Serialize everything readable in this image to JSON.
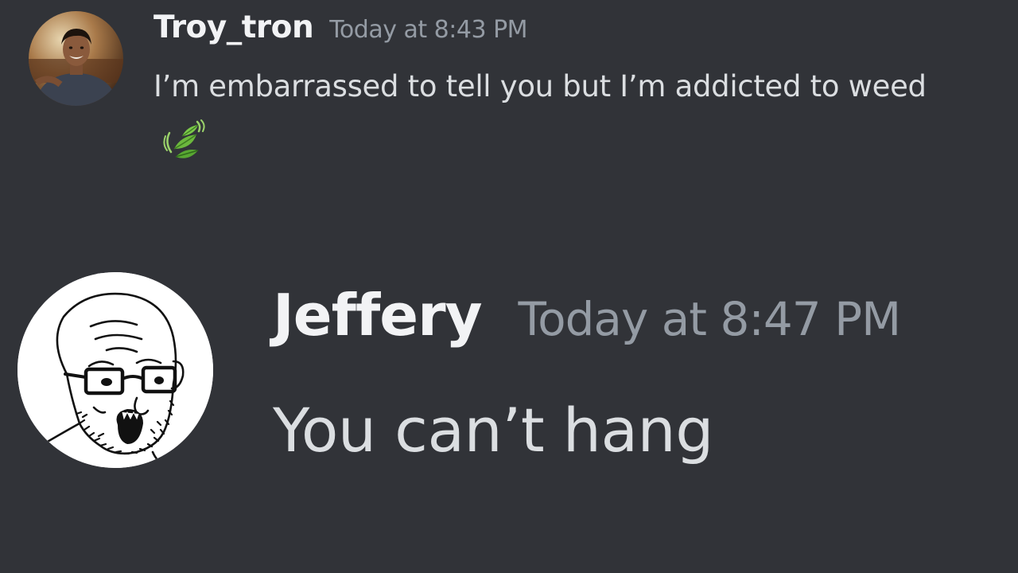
{
  "colors": {
    "background": "#313338",
    "username": "#f2f3f5",
    "timestamp": "#949ba4",
    "message_text": "#dbdee1"
  },
  "messages": [
    {
      "username": "Troy_tron",
      "timestamp": "Today at 8:43 PM",
      "content": "I’m embarrassed to tell you but I’m addicted to weed",
      "emoji": "herb-leaves-icon",
      "avatar": "user-photo-avatar"
    },
    {
      "username": "Jeffery",
      "timestamp": "Today at 8:47 PM",
      "content": "You can’t hang",
      "avatar": "wojak-soyjak-avatar"
    }
  ]
}
